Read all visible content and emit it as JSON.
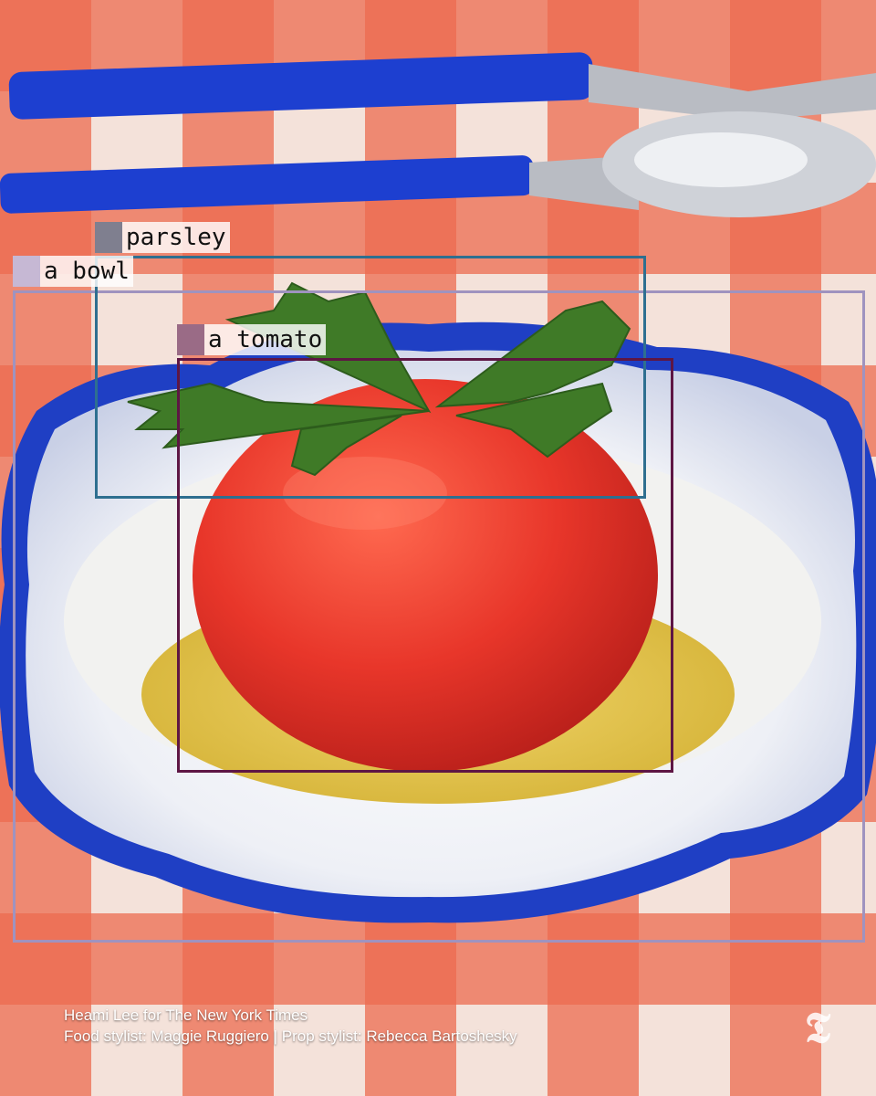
{
  "detections": [
    {
      "label": "parsley",
      "color": "#2e6f90"
    },
    {
      "label": "a bowl",
      "color": "#9f93bf"
    },
    {
      "label": "a tomato",
      "color": "#5e1644"
    }
  ],
  "credits": {
    "photographer": "Heami Lee for The New York Times",
    "stylists": "Food stylist: Maggie Ruggiero | Prop stylist: Rebecca Bartoshesky"
  },
  "logo": {
    "name": "nyt-logo",
    "text": "𝕿"
  },
  "palette": {
    "tablecloth_red": "#e8452a",
    "tablecloth_light": "#f3d9cf",
    "bowl_rim_blue": "#1f3fc4",
    "tomato_red": "#e8362a",
    "oil_yellow": "#e6c347",
    "parsley_green": "#3f7a27"
  }
}
